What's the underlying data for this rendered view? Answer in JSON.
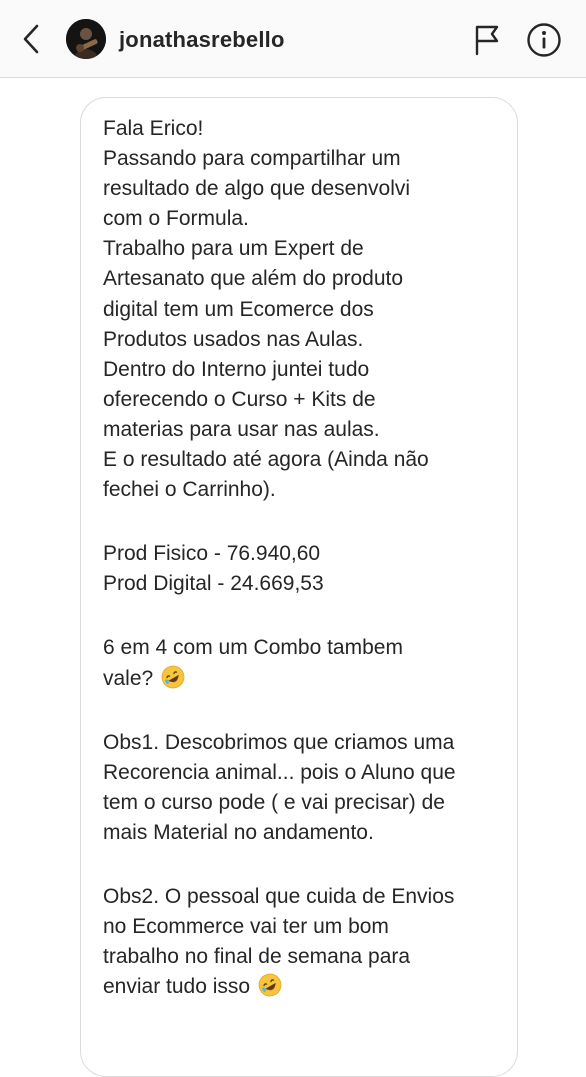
{
  "header": {
    "username": "jonathasrebello",
    "icons": {
      "back": "chevron-left-icon",
      "report": "flag-icon",
      "info": "info-icon"
    }
  },
  "message": {
    "emoji": "rolling-on-the-floor-laughing",
    "paragraphs": [
      [
        "Fala Erico!",
        "Passando para compartilhar um",
        "resultado de algo que desenvolvi",
        "com o Formula.",
        "Trabalho para um Expert de",
        "Artesanato que além do produto",
        "digital tem um Ecomerce dos",
        "Produtos usados nas Aulas.",
        "Dentro do Interno juntei tudo",
        "oferecendo o Curso + Kits de",
        "materias para usar nas aulas.",
        "E o resultado até agora (Ainda não",
        "fechei o Carrinho)."
      ],
      [
        "Prod Fisico - 76.940,60",
        "Prod Digital - 24.669,53"
      ],
      [
        "6 em 4 com um Combo tambem",
        "vale?"
      ],
      [
        "Obs1. Descobrimos que criamos uma",
        "Recorencia animal... pois o Aluno que",
        "tem o curso pode ( e vai precisar) de",
        "mais Material no andamento."
      ],
      [
        "Obs2. O pessoal que cuida de Envios",
        "no Ecommerce vai ter um bom",
        "trabalho no final de semana para",
        "enviar tudo isso"
      ]
    ]
  },
  "colors": {
    "header_bg": "#fafafa",
    "border": "#dbdbdb",
    "text": "#262626",
    "emoji_face": "#f7c53d"
  }
}
